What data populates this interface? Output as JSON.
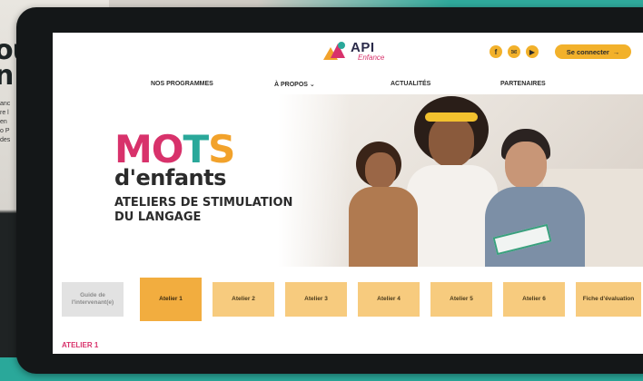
{
  "background": {
    "line1": "ou",
    "line2": "n",
    "para": [
      "anc",
      "re l",
      "en",
      "o P",
      "des"
    ]
  },
  "header": {
    "logo_main": "API",
    "logo_sub": "Enfance",
    "social": [
      {
        "icon": "facebook-icon",
        "glyph": "f"
      },
      {
        "icon": "mail-icon",
        "glyph": "✉"
      },
      {
        "icon": "youtube-icon",
        "glyph": "▶"
      }
    ],
    "login_label": "Se connecter",
    "login_icon": "→"
  },
  "nav": {
    "items": [
      "NOS PROGRAMMES",
      "À PROPOS",
      "ACTUALITÉS",
      "PARTENAIRES"
    ],
    "dropdown_glyph": "⌄"
  },
  "hero": {
    "title_parts": [
      "MO",
      "T",
      "S"
    ],
    "subtitle": "d'enfants",
    "tagline": "ATELIERS DE STIMULATION\nDU LANGAGE"
  },
  "tabs": [
    {
      "label": "Guide de l'intervenant(e)",
      "state": "guide"
    },
    {
      "label": "Atelier 1",
      "state": "active"
    },
    {
      "label": "Atelier 2",
      "state": "normal"
    },
    {
      "label": "Atelier 3",
      "state": "normal"
    },
    {
      "label": "Atelier 4",
      "state": "normal"
    },
    {
      "label": "Atelier 5",
      "state": "normal"
    },
    {
      "label": "Atelier 6",
      "state": "normal"
    },
    {
      "label": "Fiche d'évaluation",
      "state": "normal"
    }
  ],
  "section_label": "ATELIER 1",
  "colors": {
    "brand_pink": "#d8326b",
    "brand_teal": "#2aa89a",
    "brand_orange": "#f2a22b",
    "tab_active": "#f2ad3f",
    "tab_default": "#f7cb7e"
  }
}
